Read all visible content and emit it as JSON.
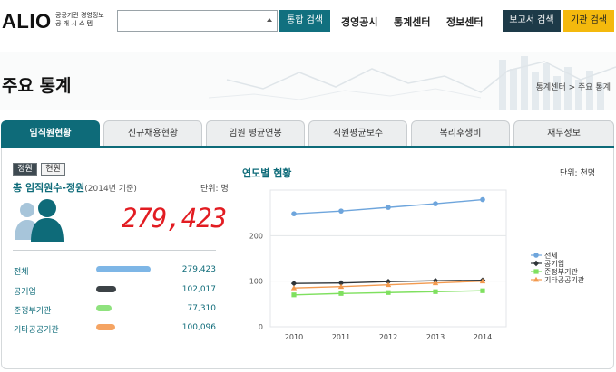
{
  "header": {
    "logo": "ALIO",
    "logo_sub_line1": "공공기관 경영정보",
    "logo_sub_line2": "공 개 시 스 템",
    "search_value": "",
    "search_button": "통합 검색",
    "nav": [
      "경영공시",
      "통계센터",
      "정보센터"
    ],
    "report_button": "보고서 검색",
    "institution_button": "기관 검색"
  },
  "page": {
    "title": "주요 통계",
    "breadcrumb": "통계센터 > 주요 통계"
  },
  "tabs": [
    {
      "label": "임직원현황",
      "active": true
    },
    {
      "label": "신규채용현황",
      "active": false
    },
    {
      "label": "임원 평균연봉",
      "active": false
    },
    {
      "label": "직원평균보수",
      "active": false
    },
    {
      "label": "복리후생비",
      "active": false
    },
    {
      "label": "재무정보",
      "active": false
    }
  ],
  "left": {
    "toggle_on": "정원",
    "toggle_off": "현원",
    "total_title": "총 임직원수-정원",
    "total_sub": "(2014년 기준)",
    "unit": "단위: 명",
    "total_value": "279,423",
    "rows": [
      {
        "label": "전체",
        "value": "279,423",
        "color": "#7eb6e6",
        "ratio": 1.0
      },
      {
        "label": "공기업",
        "value": "102,017",
        "color": "#3c4246",
        "ratio": 0.365
      },
      {
        "label": "준정부기관",
        "value": "77,310",
        "color": "#8fe27e",
        "ratio": 0.277
      },
      {
        "label": "기타공공기관",
        "value": "100,096",
        "color": "#f5a463",
        "ratio": 0.358
      }
    ]
  },
  "right": {
    "title": "연도별 현황",
    "unit": "단위: 천명"
  },
  "chart_data": {
    "type": "line",
    "title": "연도별 현황",
    "x": [
      "2010",
      "2011",
      "2012",
      "2013",
      "2014"
    ],
    "ylim": [
      0,
      300
    ],
    "yticks": [
      0,
      100,
      200
    ],
    "grid": true,
    "legend_position": "right",
    "series": [
      {
        "name": "전체",
        "color": "#6ea5dc",
        "marker": "circle",
        "values": [
          248,
          254,
          262,
          270,
          279
        ]
      },
      {
        "name": "공기업",
        "color": "#2f3539",
        "marker": "diamond",
        "values": [
          95,
          96,
          99,
          101,
          102
        ]
      },
      {
        "name": "준정부기관",
        "color": "#7fe05f",
        "marker": "square",
        "values": [
          70,
          73,
          75,
          77,
          79
        ]
      },
      {
        "name": "기타공공기관",
        "color": "#f39a4f",
        "marker": "triangle",
        "values": [
          85,
          88,
          92,
          96,
          100
        ]
      }
    ]
  }
}
